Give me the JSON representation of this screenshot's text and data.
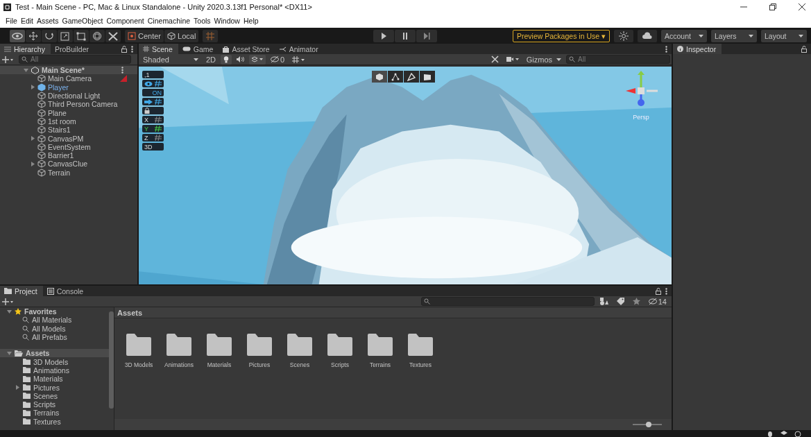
{
  "window": {
    "title": "Test - Main Scene - PC, Mac & Linux Standalone - Unity 2020.3.13f1 Personal* <DX11>"
  },
  "menu": [
    "File",
    "Edit",
    "Assets",
    "GameObject",
    "Component",
    "Cinemachine",
    "Tools",
    "Window",
    "Help"
  ],
  "toolbar": {
    "tools": [
      {
        "kind": "view",
        "selected": true
      },
      {
        "kind": "move",
        "selected": false
      },
      {
        "kind": "rotate",
        "selected": false
      },
      {
        "kind": "scale",
        "selected": false
      },
      {
        "kind": "rect",
        "selected": false
      },
      {
        "kind": "transform",
        "selected": false
      },
      {
        "kind": "custom",
        "selected": false
      }
    ],
    "pivot": [
      {
        "kind": "center",
        "label": "Center"
      },
      {
        "kind": "local",
        "label": "Local"
      }
    ],
    "preview_packages": "Preview Packages in Use ▾",
    "account": "Account",
    "layers": "Layers",
    "layout": "Layout"
  },
  "hierarchy": {
    "tabs": [
      {
        "label": "Hierarchy",
        "selected": true
      },
      {
        "label": "ProBuilder",
        "selected": false
      }
    ],
    "search": {
      "placeholder": "All"
    },
    "scene": {
      "label": "Main Scene*",
      "expanded": true,
      "children": [
        {
          "label": "Main Camera",
          "kind": "object",
          "collapsed": false
        },
        {
          "label": "Player",
          "kind": "prefab",
          "collapsed": true
        },
        {
          "label": "Directional Light",
          "kind": "object",
          "collapsed": false
        },
        {
          "label": "Third Person Camera",
          "kind": "object",
          "collapsed": false
        },
        {
          "label": "Plane",
          "kind": "object",
          "collapsed": false
        },
        {
          "label": "1st room",
          "kind": "object",
          "collapsed": false
        },
        {
          "label": "Stairs1",
          "kind": "object",
          "collapsed": false
        },
        {
          "label": "CanvasPM",
          "kind": "object",
          "collapsed": true
        },
        {
          "label": "EventSystem",
          "kind": "object",
          "collapsed": false
        },
        {
          "label": "Barrier1",
          "kind": "object",
          "collapsed": false
        },
        {
          "label": "CanvasClue",
          "kind": "object",
          "collapsed": true
        },
        {
          "label": "Terrain",
          "kind": "object",
          "collapsed": false
        }
      ]
    }
  },
  "scene_view": {
    "tabs": [
      {
        "label": "Scene",
        "kind": "scene",
        "selected": true
      },
      {
        "label": "Game",
        "kind": "game",
        "selected": false
      },
      {
        "label": "Asset Store",
        "kind": "store",
        "selected": false
      },
      {
        "label": "Animator",
        "kind": "animator",
        "selected": false
      }
    ],
    "draw_mode": "Shaded",
    "mode_2d": "2D",
    "hidden_count": "0",
    "gizmos": "Gizmos",
    "search": {
      "placeholder": "All"
    },
    "overlays": [
      {
        "kind": "snap",
        "text": ",1"
      },
      {
        "kind": "eye"
      },
      {
        "kind": "toggle",
        "text": "ON"
      },
      {
        "kind": "arrow"
      },
      {
        "kind": "lock"
      },
      {
        "kind": "axis",
        "text": "X",
        "selected": false
      },
      {
        "kind": "axis",
        "text": "Y",
        "selected": true
      },
      {
        "kind": "axis",
        "text": "Z",
        "selected": false
      },
      {
        "kind": "view",
        "text": "3D"
      }
    ],
    "projection": "Persp"
  },
  "inspector": {
    "tabs": [
      {
        "label": "Inspector",
        "selected": true
      }
    ]
  },
  "project": {
    "tabs": [
      {
        "label": "Project",
        "kind": "project",
        "selected": true
      },
      {
        "label": "Console",
        "kind": "console",
        "selected": false
      }
    ],
    "favorites": {
      "label": "Favorites",
      "expanded": true,
      "children": [
        {
          "label": "All Materials"
        },
        {
          "label": "All Models"
        },
        {
          "label": "All Prefabs"
        }
      ]
    },
    "assets": {
      "label": "Assets",
      "expanded": true,
      "selected": true,
      "children": [
        {
          "label": "3D Models",
          "collapsed": false
        },
        {
          "label": "Animations",
          "collapsed": false
        },
        {
          "label": "Materials",
          "collapsed": false
        },
        {
          "label": "Pictures",
          "collapsed": true
        },
        {
          "label": "Scenes",
          "collapsed": false
        },
        {
          "label": "Scripts",
          "collapsed": false
        },
        {
          "label": "Terrains",
          "collapsed": false
        },
        {
          "label": "Textures",
          "collapsed": false
        }
      ]
    },
    "breadcrumb": "Assets",
    "hidden_count": "14",
    "folders": [
      "3D Models",
      "Animations",
      "Materials",
      "Pictures",
      "Scenes",
      "Scripts",
      "Terrains",
      "Textures"
    ],
    "zoom": {
      "level": 0.55
    }
  }
}
